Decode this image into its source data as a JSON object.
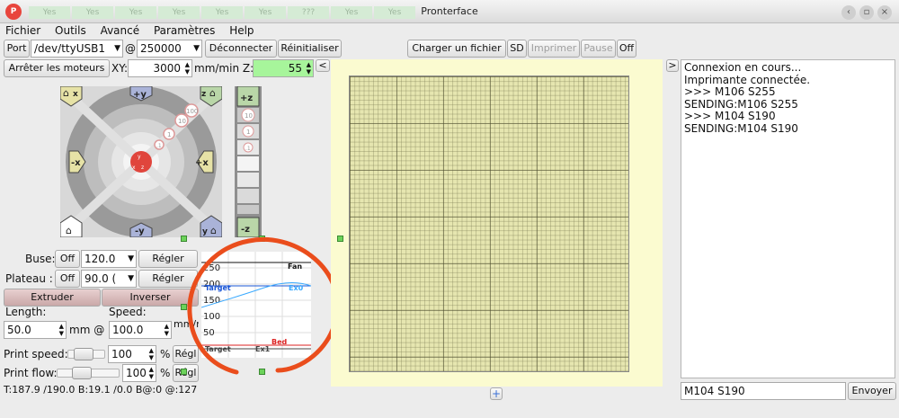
{
  "titlebar": {
    "app_icon_text": "P",
    "title": "Pronterface",
    "bg_tabs": [
      "Yes",
      "Yes",
      "Yes",
      "Yes",
      "Yes",
      "Yes",
      "???",
      "Yes",
      "Yes"
    ],
    "controls": [
      "minimize-icon",
      "restore-icon",
      "close-icon"
    ]
  },
  "menu": [
    "Fichier",
    "Outils",
    "Avancé",
    "Paramètres",
    "Help"
  ],
  "toolbar": {
    "port_label": "Port",
    "port_value": "/dev/ttyUSB1",
    "at": "@",
    "baud_value": "250000",
    "disconnect": "Déconnecter",
    "reset": "Réinitialiser",
    "load_file": "Charger un fichier",
    "sd": "SD",
    "print": "Imprimer",
    "pause": "Pause",
    "off": "Off"
  },
  "motion": {
    "stop_motors": "Arrêter les moteurs",
    "xy_label": "XY:",
    "xy_speed": "3000",
    "xy_unit": "mm/min Z:",
    "z_speed": "55",
    "collapse": "<"
  },
  "jog": {
    "y_plus": "+y",
    "y_minus": "-y",
    "x_plus": "+x",
    "x_minus": "-x",
    "z_plus": "+z",
    "z_minus": "-z",
    "home_x": "x",
    "home_y": "y",
    "home_z": "z",
    "steps": [
      "100",
      "10",
      "1",
      ".1"
    ],
    "z_steps": [
      "10",
      "1",
      ".1"
    ]
  },
  "temps": {
    "nozzle_label": "Buse:",
    "nozzle_off": "Off",
    "nozzle_value": "120.0",
    "nozzle_set": "Régler",
    "bed_label": "Plateau :",
    "bed_off": "Off",
    "bed_value": "90.0 (",
    "bed_set": "Régler"
  },
  "extrude": {
    "extrude": "Extruder",
    "reverse": "Inverser",
    "length_label": "Length:",
    "speed_label": "Speed:",
    "length_value": "50.0",
    "mm_at": "mm @",
    "speed_value": "100.0",
    "speed_unit": "mm/min"
  },
  "print_speed": {
    "label": "Print speed:",
    "value": "100",
    "unit": "%",
    "button": "Régl",
    "slider_level": 0.35
  },
  "print_flow": {
    "label": "Print flow:",
    "value": "100",
    "unit": "%",
    "button": "Régl",
    "slider_level": 0.35
  },
  "status": "T:187.9 /190.0 B:19.1 /0.0 B@:0 @:127",
  "console": {
    "expand": ">",
    "lines": [
      "Connexion en cours...",
      "Imprimante connectée.",
      ">>> M106 S255",
      "SENDING:M106 S255",
      ">>> M104 S190",
      "SENDING:M104 S190"
    ],
    "command_value": "M104 S190",
    "send": "Envoyer"
  },
  "plater": {
    "add": "+"
  },
  "graph": {
    "y_ticks": [
      "250",
      "200",
      "150",
      "100",
      "50"
    ],
    "labels": {
      "fan": "Fan",
      "ex0": "Ex0",
      "target_top": "Target",
      "bed": "Bed",
      "target_bottom": "Target",
      "ex1": "Ex1"
    }
  },
  "colors": {
    "accent_green": "#a7f59b",
    "bed_grid": "#e6e6b0",
    "annotation": "#ea4d1c"
  }
}
